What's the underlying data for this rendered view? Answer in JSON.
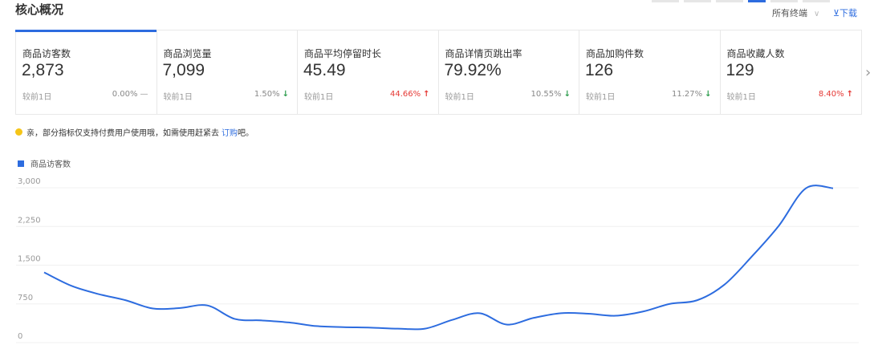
{
  "header": {
    "title": "核心概况",
    "filter_label": "所有终端",
    "download_label": "⊻下载"
  },
  "metrics": [
    {
      "label": "商品访客数",
      "value": "2,873",
      "compare": "较前1日",
      "pct": "0.00%",
      "trend": "flat"
    },
    {
      "label": "商品浏览量",
      "value": "7,099",
      "compare": "较前1日",
      "pct": "1.50%",
      "trend": "down"
    },
    {
      "label": "商品平均停留时长",
      "value": "45.49",
      "compare": "较前1日",
      "pct": "44.66%",
      "trend": "up"
    },
    {
      "label": "商品详情页跳出率",
      "value": "79.92%",
      "compare": "较前1日",
      "pct": "10.55%",
      "trend": "down"
    },
    {
      "label": "商品加购件数",
      "value": "126",
      "compare": "较前1日",
      "pct": "11.27%",
      "trend": "down"
    },
    {
      "label": "商品收藏人数",
      "value": "129",
      "compare": "较前1日",
      "pct": "8.40%",
      "trend": "up"
    }
  ],
  "notice": {
    "text": "亲，部分指标仅支持付费用户使用哦，如需使用赶紧去",
    "link": "订购",
    "suffix": "吧。"
  },
  "colors": {
    "accent": "#2d6cdf",
    "up": "#e53935",
    "down": "#2e9d4e",
    "notice_dot": "#f5c518"
  },
  "chart_data": {
    "type": "line",
    "series": [
      {
        "name": "商品访客数",
        "values": [
          1220,
          960,
          800,
          680,
          520,
          530,
          580,
          320,
          290,
          250,
          180,
          160,
          150,
          130,
          130,
          300,
          430,
          210,
          340,
          430,
          420,
          380,
          460,
          610,
          680,
          980,
          1520,
          2120,
          2850,
          2850
        ]
      }
    ],
    "yticks": [
      "3,000",
      "2,250",
      "1,500",
      "750",
      "0"
    ],
    "ylim": [
      0,
      3000
    ],
    "grid": true
  }
}
